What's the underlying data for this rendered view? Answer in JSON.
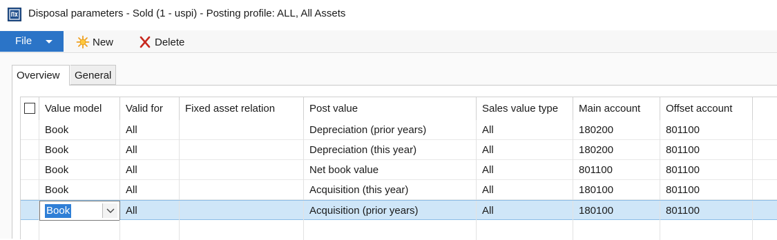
{
  "window": {
    "title": "Disposal parameters - Sold (1 - uspi) - Posting profile: ALL, All Assets",
    "app_icon": "dynamics-ax-icon"
  },
  "toolbar": {
    "file_label": "File",
    "new_label": "New",
    "delete_label": "Delete"
  },
  "tabs": [
    {
      "label": "Overview",
      "active": true
    },
    {
      "label": "General",
      "active": false
    }
  ],
  "grid": {
    "columns": [
      "Value model",
      "Valid for",
      "Fixed asset relation",
      "Post value",
      "Sales value type",
      "Main account",
      "Offset account"
    ],
    "rows": [
      {
        "value_model": "Book",
        "valid_for": "All",
        "fixed_asset_relation": "",
        "post_value": "Depreciation (prior years)",
        "sales_value_type": "All",
        "main_account": "180200",
        "offset_account": "801100"
      },
      {
        "value_model": "Book",
        "valid_for": "All",
        "fixed_asset_relation": "",
        "post_value": "Depreciation (this year)",
        "sales_value_type": "All",
        "main_account": "180200",
        "offset_account": "801100"
      },
      {
        "value_model": "Book",
        "valid_for": "All",
        "fixed_asset_relation": "",
        "post_value": "Net book value",
        "sales_value_type": "All",
        "main_account": "801100",
        "offset_account": "801100"
      },
      {
        "value_model": "Book",
        "valid_for": "All",
        "fixed_asset_relation": "",
        "post_value": "Acquisition (this year)",
        "sales_value_type": "All",
        "main_account": "180100",
        "offset_account": "801100"
      },
      {
        "value_model": "Book",
        "valid_for": "All",
        "fixed_asset_relation": "",
        "post_value": "Acquisition (prior years)",
        "sales_value_type": "All",
        "main_account": "180100",
        "offset_account": "801100"
      }
    ]
  },
  "colors": {
    "file_button": "#2b74c7",
    "selected_row": "#cfe6f8",
    "selection_highlight": "#2f7fd6"
  }
}
